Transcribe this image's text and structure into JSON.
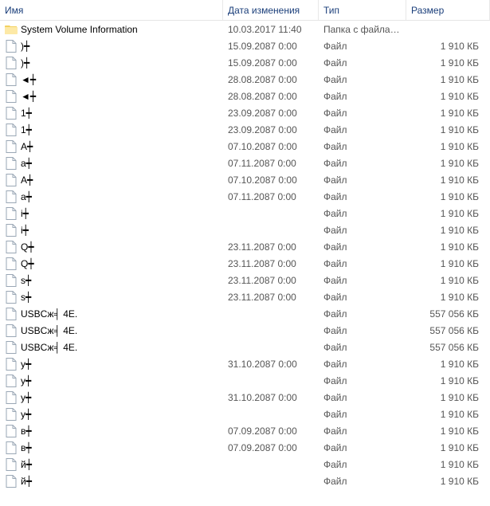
{
  "columns": {
    "name": "Имя",
    "date": "Дата изменения",
    "type": "Тип",
    "size": "Размер"
  },
  "items": [
    {
      "icon": "folder",
      "name": "System Volume Information",
      "date": "10.03.2017 11:40",
      "type": "Папка с файлами",
      "size": ""
    },
    {
      "icon": "file",
      "name": ")┿",
      "date": "15.09.2087 0:00",
      "type": "Файл",
      "size": "1 910 КБ"
    },
    {
      "icon": "file",
      "name": ")┿",
      "date": "15.09.2087 0:00",
      "type": "Файл",
      "size": "1 910 КБ"
    },
    {
      "icon": "file",
      "name": "◄┿",
      "date": "28.08.2087 0:00",
      "type": "Файл",
      "size": "1 910 КБ"
    },
    {
      "icon": "file",
      "name": "◄┿",
      "date": "28.08.2087 0:00",
      "type": "Файл",
      "size": "1 910 КБ"
    },
    {
      "icon": "file",
      "name": "1┿",
      "date": "23.09.2087 0:00",
      "type": "Файл",
      "size": "1 910 КБ"
    },
    {
      "icon": "file",
      "name": "1┿",
      "date": "23.09.2087 0:00",
      "type": "Файл",
      "size": "1 910 КБ"
    },
    {
      "icon": "file",
      "name": "А┿",
      "date": "07.10.2087 0:00",
      "type": "Файл",
      "size": "1 910 КБ"
    },
    {
      "icon": "file",
      "name": "а┿",
      "date": "07.11.2087 0:00",
      "type": "Файл",
      "size": "1 910 КБ"
    },
    {
      "icon": "file",
      "name": "А┿",
      "date": "07.10.2087 0:00",
      "type": "Файл",
      "size": "1 910 КБ"
    },
    {
      "icon": "file",
      "name": "а┿",
      "date": "07.11.2087 0:00",
      "type": "Файл",
      "size": "1 910 КБ"
    },
    {
      "icon": "file",
      "name": "i┿",
      "date": "",
      "type": "Файл",
      "size": "1 910 КБ"
    },
    {
      "icon": "file",
      "name": "i┿",
      "date": "",
      "type": "Файл",
      "size": "1 910 КБ"
    },
    {
      "icon": "file",
      "name": "Q┿",
      "date": "23.11.2087 0:00",
      "type": "Файл",
      "size": "1 910 КБ"
    },
    {
      "icon": "file",
      "name": "Q┿",
      "date": "23.11.2087 0:00",
      "type": "Файл",
      "size": "1 910 КБ"
    },
    {
      "icon": "file",
      "name": "s┿",
      "date": "23.11.2087 0:00",
      "type": "Файл",
      "size": "1 910 КБ"
    },
    {
      "icon": "file",
      "name": "s┿",
      "date": "23.11.2087 0:00",
      "type": "Файл",
      "size": "1 910 КБ"
    },
    {
      "icon": "file",
      "name": "USBCж╡ 4Е.",
      "date": "",
      "type": "Файл",
      "size": "557 056 КБ"
    },
    {
      "icon": "file",
      "name": "USBCж╡ 4Е.",
      "date": "",
      "type": "Файл",
      "size": "557 056 КБ"
    },
    {
      "icon": "file",
      "name": "USBCж╡ 4Е.",
      "date": "",
      "type": "Файл",
      "size": "557 056 КБ"
    },
    {
      "icon": "file",
      "name": "у┿",
      "date": "31.10.2087 0:00",
      "type": "Файл",
      "size": "1 910 КБ"
    },
    {
      "icon": "file",
      "name": "у┿",
      "date": "",
      "type": "Файл",
      "size": "1 910 КБ"
    },
    {
      "icon": "file",
      "name": "у┿",
      "date": "31.10.2087 0:00",
      "type": "Файл",
      "size": "1 910 КБ"
    },
    {
      "icon": "file",
      "name": "у┿",
      "date": "",
      "type": "Файл",
      "size": "1 910 КБ"
    },
    {
      "icon": "file",
      "name": "в┿",
      "date": "07.09.2087 0:00",
      "type": "Файл",
      "size": "1 910 КБ"
    },
    {
      "icon": "file",
      "name": "в┿",
      "date": "07.09.2087 0:00",
      "type": "Файл",
      "size": "1 910 КБ"
    },
    {
      "icon": "file",
      "name": "й┿",
      "date": "",
      "type": "Файл",
      "size": "1 910 КБ"
    },
    {
      "icon": "file",
      "name": "й┿",
      "date": "",
      "type": "Файл",
      "size": "1 910 КБ"
    }
  ]
}
